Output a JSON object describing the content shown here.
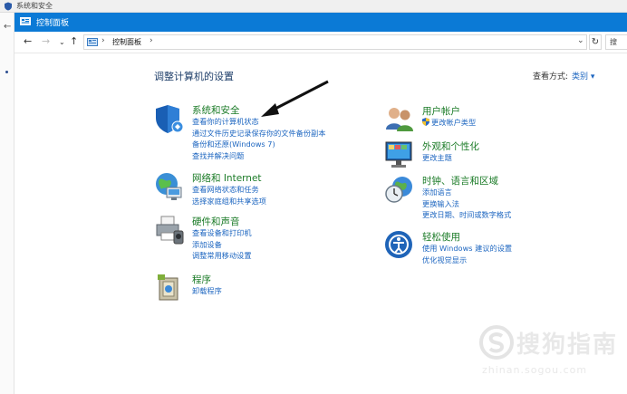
{
  "background_window": {
    "title": "系统和安全",
    "back_glyph": "←"
  },
  "window": {
    "title": "控制面板"
  },
  "address_bar": {
    "back_glyph": "←",
    "forward_glyph": "→",
    "dropdown_glyph": "⌄",
    "up_glyph": "↑",
    "separator_glyph": "›",
    "crumb": "控制面板",
    "crumb_separator": "›",
    "address_dropdown_glyph": "⌄",
    "refresh_glyph": "↻",
    "search_placeholder": "搜"
  },
  "main": {
    "heading": "调整计算机的设置",
    "view_by_label": "查看方式:",
    "view_by_value": "类别 ▾"
  },
  "categories": {
    "system_security": {
      "title": "系统和安全",
      "links": [
        "查看你的计算机状态",
        "通过文件历史记录保存你的文件备份副本",
        "备份和还原(Windows 7)",
        "查找并解决问题"
      ]
    },
    "network": {
      "title": "网络和 Internet",
      "links": [
        "查看网络状态和任务",
        "选择家庭组和共享选项"
      ]
    },
    "hardware": {
      "title": "硬件和声音",
      "links": [
        "查看设备和打印机",
        "添加设备",
        "调整常用移动设置"
      ]
    },
    "programs": {
      "title": "程序",
      "links": [
        "卸载程序"
      ]
    },
    "user_accounts": {
      "title": "用户帐户",
      "links": [
        "更改帐户类型"
      ]
    },
    "appearance": {
      "title": "外观和个性化",
      "links": [
        "更改主题"
      ]
    },
    "clock_region": {
      "title": "时钟、语言和区域",
      "links": [
        "添加语言",
        "更换输入法",
        "更改日期、时间或数字格式"
      ]
    },
    "ease_access": {
      "title": "轻松使用",
      "links": [
        "使用 Windows 建议的设置",
        "优化视觉显示"
      ]
    }
  },
  "watermark": {
    "text": "搜狗指南",
    "url": "zhinan.sogou.com"
  },
  "colors": {
    "titlebar": "#0b7ad6",
    "link": "#1d66c0",
    "category_title": "#1b7b27",
    "heading": "#1f3f6a"
  }
}
